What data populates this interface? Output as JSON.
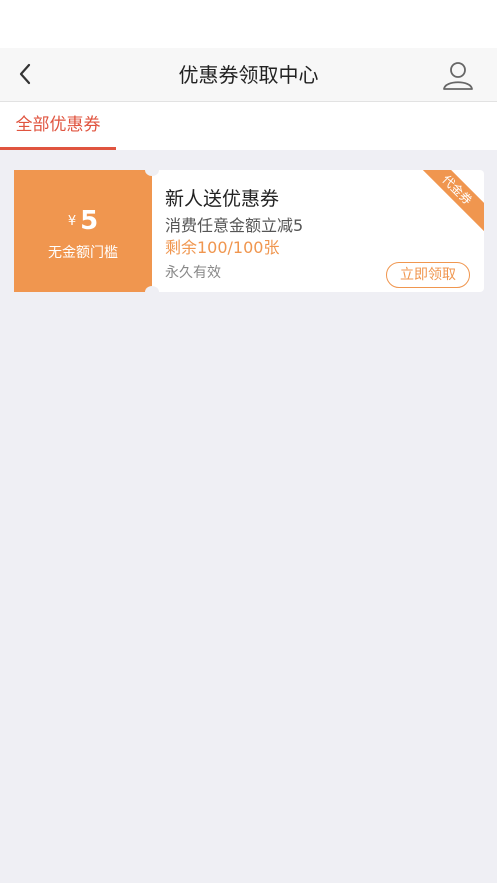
{
  "nav": {
    "title": "优惠券领取中心",
    "back_icon": "chevron-left-icon",
    "user_icon": "user-icon"
  },
  "tabs": [
    {
      "label": "全部优惠券",
      "active": true
    }
  ],
  "coupons": [
    {
      "currency": "¥",
      "amount": "5",
      "threshold": "无金额门槛",
      "title": "新人送优惠券",
      "description": "消费任意金额立减5",
      "remaining": "剩余100/100张",
      "validity": "永久有效",
      "claim_label": "立即领取",
      "ribbon": "代金券"
    }
  ],
  "colors": {
    "accent": "#e0543f",
    "coupon_orange": "#f0964f",
    "background": "#efeff4"
  }
}
